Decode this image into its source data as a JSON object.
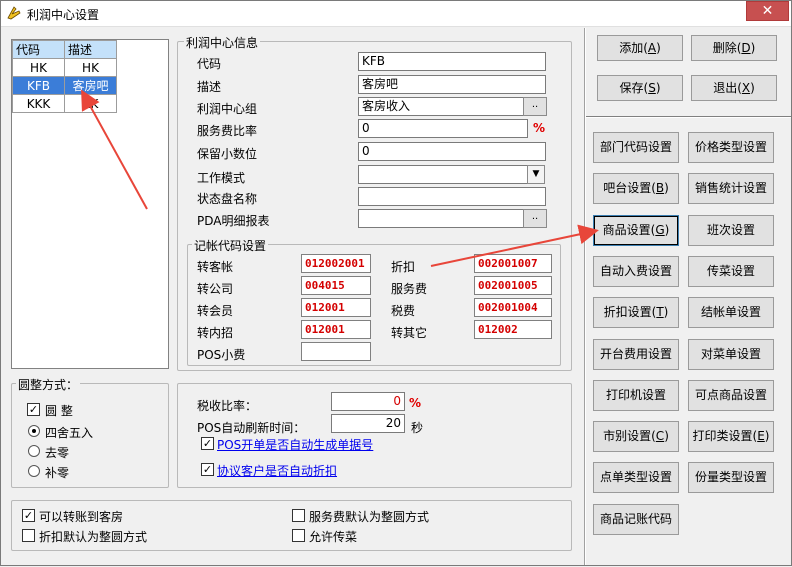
{
  "window": {
    "title": "利润中心设置",
    "close_glyph": "✕"
  },
  "grid": {
    "headers": [
      "代码",
      "描述"
    ],
    "rows": [
      [
        "HK",
        "HK"
      ],
      [
        "KFB",
        "客房吧"
      ],
      [
        "KKK",
        "KK"
      ]
    ],
    "selected_row": 1
  },
  "info": {
    "group_label": "利润中心信息",
    "code_label": "代码",
    "code_value": "KFB",
    "desc_label": "描述",
    "desc_value": "客房吧",
    "group_center_label": "利润中心组",
    "group_center_value": "客房收入",
    "service_rate_label": "服务费比率",
    "service_rate_value": "0",
    "decimal_label": "保留小数位",
    "decimal_value": "0",
    "work_mode_label": "工作模式",
    "work_mode_value": "",
    "status_label": "状态盘名称",
    "status_value": "",
    "pda_label": "PDA明细报表",
    "pda_value": "",
    "ellipsis": "..",
    "percent": "%"
  },
  "billing": {
    "group_label": "记帐代码设置",
    "transfer_guest_label": "转客帐",
    "transfer_guest_value": "012002001",
    "discount_label": "折扣",
    "discount_value": "002001007",
    "transfer_company_label": "转公司",
    "transfer_company_value": "004015",
    "service_fee_label": "服务费",
    "service_fee_value": "002001005",
    "transfer_member_label": "转会员",
    "transfer_member_value": "012001",
    "tax_label": "税费",
    "tax_value": "002001004",
    "transfer_internal_label": "转内招",
    "transfer_internal_value": "012001",
    "transfer_other_label": "转其它",
    "transfer_other_value": "012002",
    "pos_tip_label": "POS小费",
    "pos_tip_value": ""
  },
  "rounding": {
    "group_label": "圆整方式：",
    "round_label": "圆  整",
    "round_checked": true,
    "options": [
      "四舍五入",
      "去零",
      "补零"
    ],
    "selected": 0
  },
  "tax": {
    "tax_rate_label": "税收比率：",
    "tax_rate_value": "0",
    "percent": "%",
    "refresh_label": "POS自动刷新时间：",
    "refresh_value": "20",
    "refresh_unit": "秒",
    "pos_split_label": "POS开单是否自动生成单据号",
    "pos_split_checked": true,
    "agreement_label": "协议客户是否自动折扣",
    "agreement_checked": true
  },
  "bottom": {
    "transfer_room_label": "可以转账到客房",
    "transfer_room_checked": true,
    "discount_round_label": "折扣默认为整圆方式",
    "discount_round_checked": false,
    "service_round_label": "服务费默认为整圆方式",
    "service_round_checked": false,
    "allow_dish_label": "允许传菜",
    "allow_dish_checked": false
  },
  "actions": {
    "add": [
      "添加(",
      "A",
      ")"
    ],
    "delete": [
      "删除(",
      "D",
      ")"
    ],
    "save": [
      "保存(",
      "S",
      ")"
    ],
    "exit": [
      "退出(",
      "X",
      ")"
    ]
  },
  "settings_buttons": [
    [
      "部门代码设置"
    ],
    [
      "价格类型设置"
    ],
    [
      "吧台设置(",
      "B",
      ")"
    ],
    [
      "销售统计设置"
    ],
    [
      "商品设置(",
      "G",
      ")"
    ],
    [
      "班次设置"
    ],
    [
      "自动入费设置"
    ],
    [
      "传菜设置"
    ],
    [
      "折扣设置(",
      "T",
      ")"
    ],
    [
      "结帐单设置"
    ],
    [
      "开台费用设置"
    ],
    [
      "对菜单设置"
    ],
    [
      "打印机设置"
    ],
    [
      "可点商品设置"
    ],
    [
      "市别设置(",
      "C",
      ")"
    ],
    [
      "打印类设置(",
      "E",
      ")"
    ],
    [
      "点单类型设置"
    ],
    [
      "份量类型设置"
    ],
    [
      "商品记账代码"
    ]
  ],
  "colors": {
    "arrow": "#e8463a",
    "selection": "#3b7dd8",
    "header": "#c4e1fa",
    "code_text": "#d40000"
  }
}
